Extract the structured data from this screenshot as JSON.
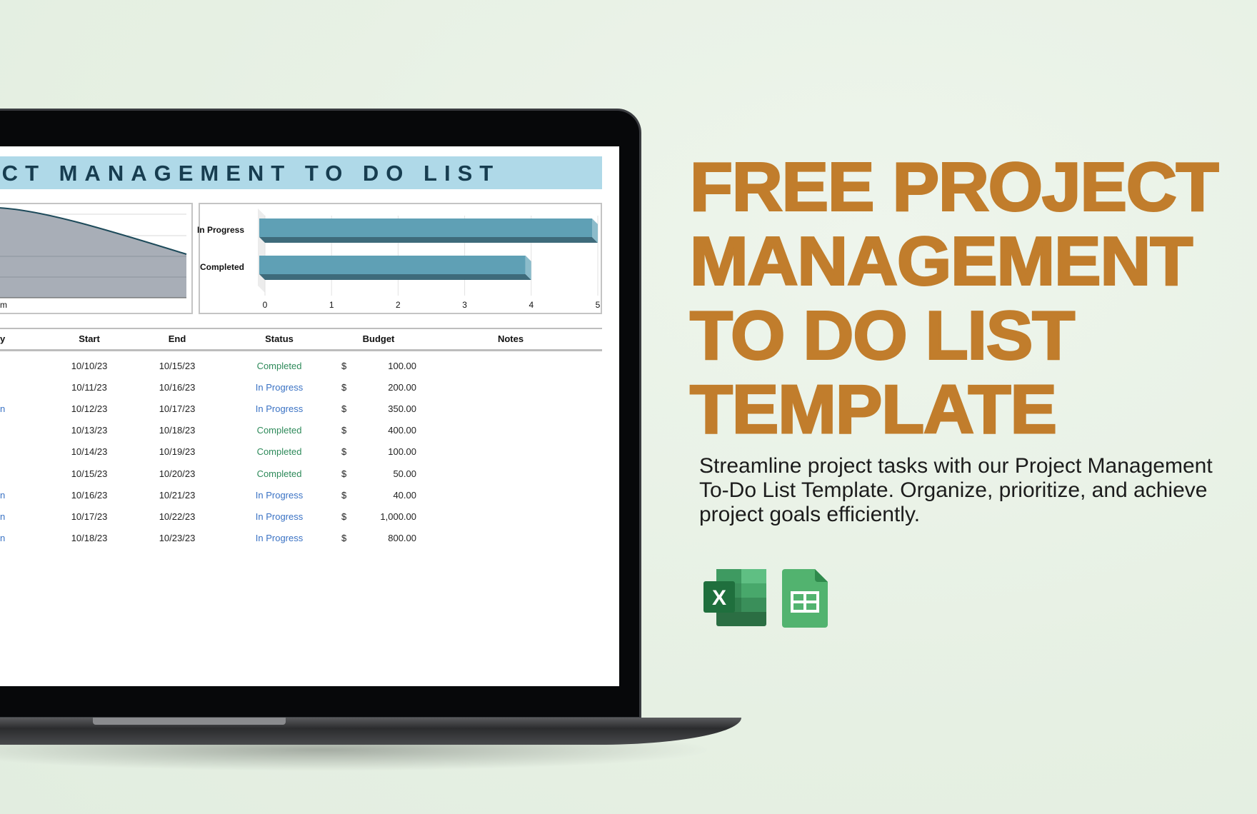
{
  "spreadsheet": {
    "title": "ECT MANAGEMENT TO DO LIST",
    "area_chart_fragment": {
      "axis_label": "m"
    },
    "table": {
      "headers": {
        "priority": "y",
        "start": "Start",
        "end": "End",
        "status": "Status",
        "budget": "Budget",
        "notes": "Notes"
      },
      "rows": [
        {
          "priority": "",
          "start": "10/10/23",
          "end": "10/15/23",
          "status": "Completed",
          "currency": "$",
          "budget": "100.00"
        },
        {
          "priority": "",
          "start": "10/11/23",
          "end": "10/16/23",
          "status": "In Progress",
          "currency": "$",
          "budget": "200.00"
        },
        {
          "priority": "n",
          "start": "10/12/23",
          "end": "10/17/23",
          "status": "In Progress",
          "currency": "$",
          "budget": "350.00"
        },
        {
          "priority": "",
          "start": "10/13/23",
          "end": "10/18/23",
          "status": "Completed",
          "currency": "$",
          "budget": "400.00"
        },
        {
          "priority": "",
          "start": "10/14/23",
          "end": "10/19/23",
          "status": "Completed",
          "currency": "$",
          "budget": "100.00"
        },
        {
          "priority": "",
          "start": "10/15/23",
          "end": "10/20/23",
          "status": "Completed",
          "currency": "$",
          "budget": "50.00"
        },
        {
          "priority": "n",
          "start": "10/16/23",
          "end": "10/21/23",
          "status": "In Progress",
          "currency": "$",
          "budget": "40.00"
        },
        {
          "priority": "n",
          "start": "10/17/23",
          "end": "10/22/23",
          "status": "In Progress",
          "currency": "$",
          "budget": "1,000.00"
        },
        {
          "priority": "n",
          "start": "10/18/23",
          "end": "10/23/23",
          "status": "In Progress",
          "currency": "$",
          "budget": "800.00"
        }
      ]
    }
  },
  "chart_data": {
    "type": "bar",
    "orientation": "horizontal",
    "style": "3d",
    "categories": [
      "In Progress",
      "Completed"
    ],
    "values": [
      5,
      4
    ],
    "xlim": [
      0,
      5
    ],
    "xticks": [
      "0",
      "1",
      "2",
      "3",
      "4",
      "5"
    ],
    "grid": true,
    "bar_color": "#5fa0b5"
  },
  "promo": {
    "headline": [
      "FREE PROJECT",
      "MANAGEMENT",
      "TO DO LIST",
      "TEMPLATE"
    ],
    "description": "Streamline project tasks with our Project Management To-Do List Template. Organize, prioritize, and achieve project goals efficiently.",
    "icons": [
      "excel-icon",
      "google-sheets-icon"
    ]
  },
  "colors": {
    "headline": "#c17d2c",
    "completed": "#2e8a5a",
    "in_progress": "#3a72c4",
    "title_band": "#afd9e8",
    "title_text": "#173d50"
  }
}
